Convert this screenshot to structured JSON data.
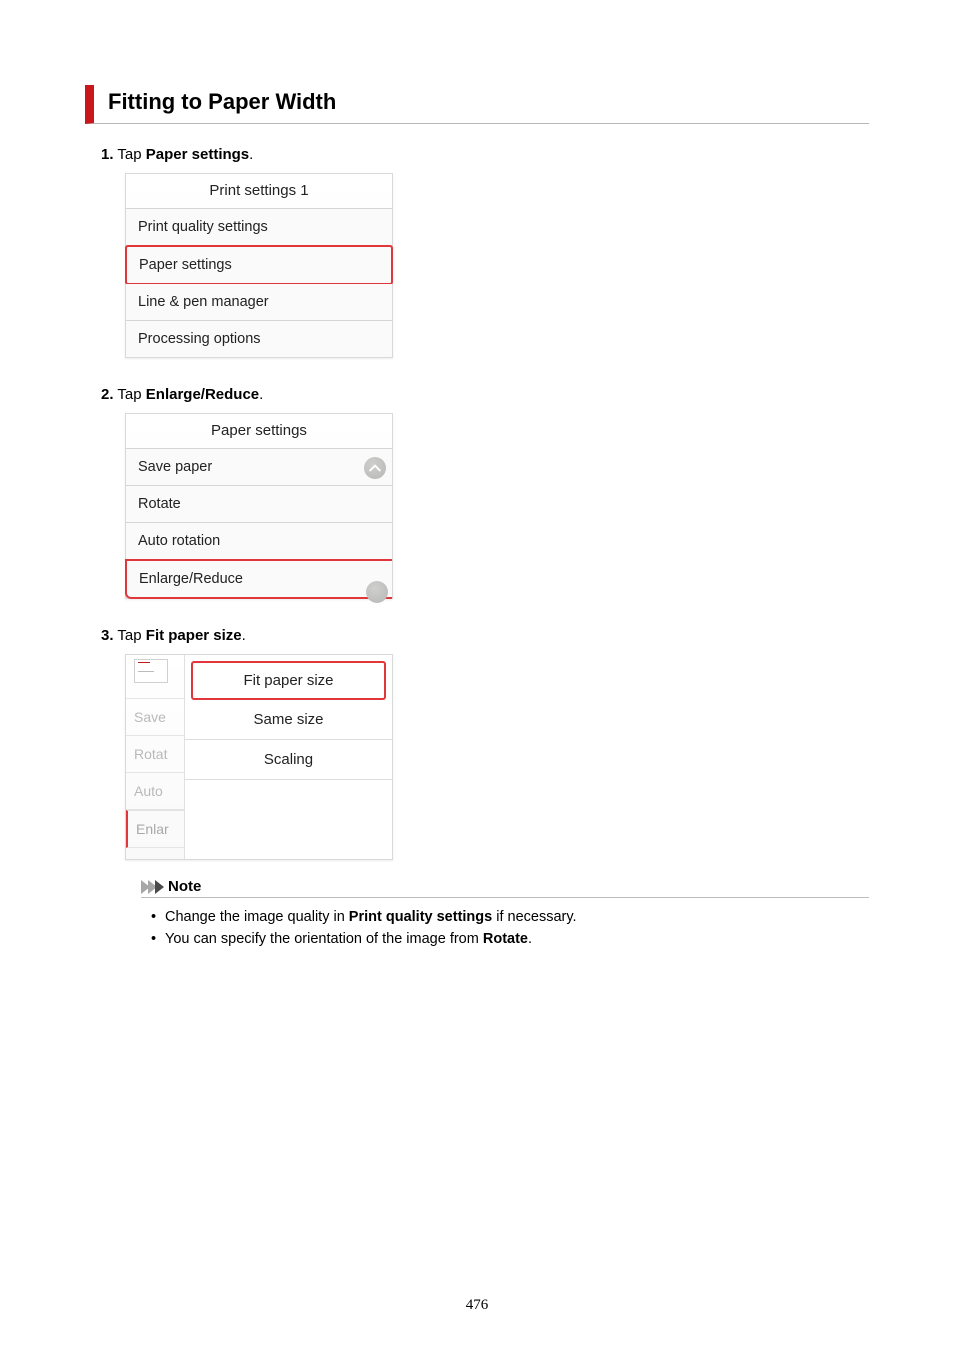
{
  "title": "Fitting to Paper Width",
  "steps": {
    "s1": {
      "num": "1.",
      "pre": "Tap ",
      "bold": "Paper settings",
      "post": "."
    },
    "s2": {
      "num": "2.",
      "pre": "Tap ",
      "bold": "Enlarge/Reduce",
      "post": "."
    },
    "s3": {
      "num": "3.",
      "pre": "Tap ",
      "bold": "Fit paper size",
      "post": "."
    }
  },
  "shot1": {
    "header": "Print settings 1",
    "rows": [
      "Print quality settings",
      "Paper settings",
      "Line & pen manager",
      "Processing options"
    ]
  },
  "shot2": {
    "header": "Paper settings",
    "rows": [
      "Save paper",
      "Rotate",
      "Auto rotation",
      "Enlarge/Reduce"
    ]
  },
  "shot3": {
    "under": [
      "Save",
      "Rotat",
      "Auto",
      "Enlar"
    ],
    "popup": [
      "Fit paper size",
      "Same size",
      "Scaling"
    ]
  },
  "note": {
    "title": "Note",
    "items": [
      {
        "pre": "Change the image quality in ",
        "bold": "Print quality settings",
        "post": " if necessary."
      },
      {
        "pre": "You can specify the orientation of the image from ",
        "bold": "Rotate",
        "post": "."
      }
    ]
  },
  "page_number": "476"
}
